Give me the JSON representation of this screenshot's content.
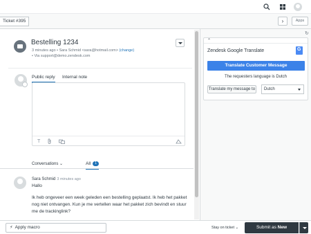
{
  "header": {
    "search_icon": "search-icon",
    "apps_grid_icon": "grid-icon",
    "avatar": "user-avatar"
  },
  "tabs": {
    "ticket_tab": "Ticket #395",
    "next_label": "›",
    "apps_label": "Apps"
  },
  "ticket": {
    "subject": "Bestelling 1234",
    "time_ago": "3 minutes ago",
    "requester": "Sara Schmid <sara@hotmail.com>",
    "change_link": "(change)",
    "via": "Via support@demo.zendesk.com"
  },
  "composer": {
    "public_reply_tab": "Public reply",
    "internal_note_tab": "Internal note",
    "toolbar_icons": [
      "text-format-icon",
      "attachment-icon",
      "link-icon",
      "expand-icon"
    ]
  },
  "conversation_filter": {
    "conversations_label": "Conversations",
    "all_label": "All",
    "all_count": "1"
  },
  "message": {
    "author": "Sara Schmid",
    "time": "3 minutes ago",
    "greeting": "Hallo",
    "body": "Ik heb ongeveer een week geleden een bestelling geplaatst. Ik heb het pakket nog niet ontvangen. Kun je me vertellen waar het pakket zich bevindt en stuur me de trackinglink?"
  },
  "app": {
    "title": "Zendesk Google Translate",
    "translate_button": "Translate Customer Message",
    "language_line": "The requesters language is Dutch",
    "translate_my_button": "Translate my message to",
    "language_selected": "Dutch"
  },
  "footer": {
    "macro_label": "Apply macro",
    "stay_label": "Stay on ticket ⌄",
    "submit_prefix": "Submit as ",
    "submit_status": "New"
  },
  "colors": {
    "accent": "#1f73b7",
    "translate_button": "#3b82e8",
    "submit": "#2f3941"
  }
}
